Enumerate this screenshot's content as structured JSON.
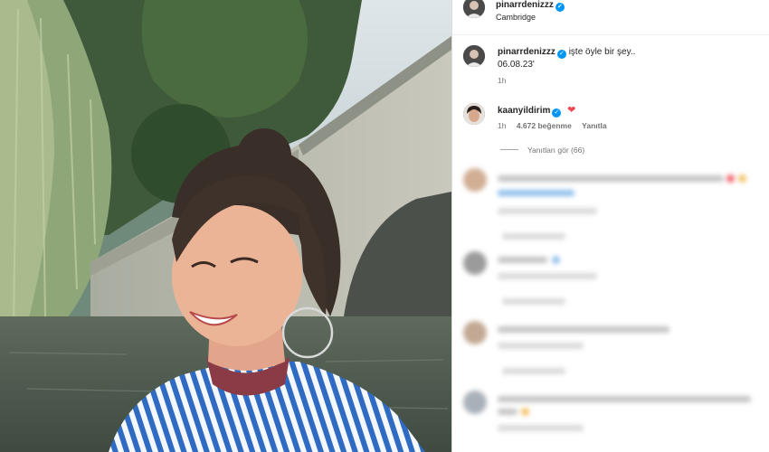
{
  "post": {
    "username": "pinarrdenizzz",
    "location": "Cambridge",
    "caption_user": "pinarrdenizzz",
    "caption_text": "işte öyle bir şey..",
    "caption_date": "06.08.23'",
    "caption_time": "1h"
  },
  "comment": {
    "username": "kaanyildirim",
    "heart": "❤",
    "time": "1h",
    "likes": "4.672 beğenme",
    "reply_label": "Yanıtla",
    "view_replies": "Yanıtları gör (66)"
  },
  "colors": {
    "verified": "#0095f6",
    "heart": "#ed4956",
    "secondary_text": "#737373"
  },
  "icons": [
    "verified-badge-icon",
    "heart-icon"
  ]
}
